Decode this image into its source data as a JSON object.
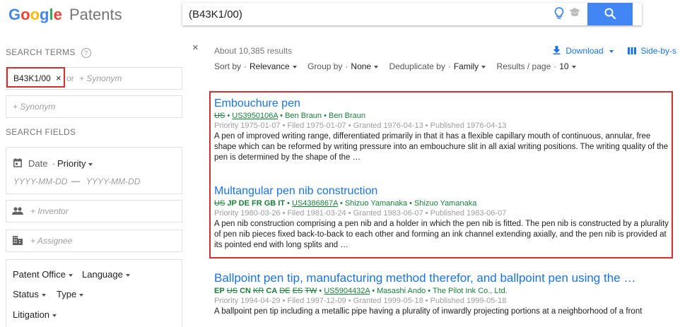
{
  "header": {
    "logo_letters": [
      "G",
      "o",
      "o",
      "g",
      "l",
      "e"
    ],
    "logo_colors": [
      "#4285f4",
      "#ea4335",
      "#fbbc05",
      "#4285f4",
      "#34a853",
      "#ea4335"
    ],
    "logo_suffix": "Patents",
    "search_query": "(B43K1/00)",
    "icons": {
      "bulb": "lightbulb-icon",
      "cap": "graduation-cap-icon",
      "search": "search-icon"
    }
  },
  "sidebar": {
    "search_terms_title": "SEARCH TERMS",
    "help_symbol": "?",
    "chip_label": "B43K1/00",
    "chip_remove": "×",
    "or_text": "or",
    "synonym_placeholder": "+ Synonym",
    "synonym_placeholder_2": "+ Synonym",
    "search_fields_title": "SEARCH FIELDS",
    "date_label": "Date",
    "date_sep": "·",
    "date_type": "Priority",
    "date_from_placeholder": "YYYY-MM-DD",
    "date_dash": "—",
    "date_to_placeholder": "YYYY-MM-DD",
    "inventor_placeholder": "+ Inventor",
    "assignee_placeholder": "+ Assignee",
    "filters": {
      "patent_office": "Patent Office",
      "language": "Language",
      "status": "Status",
      "type": "Type",
      "litigation": "Litigation"
    }
  },
  "results_header": {
    "close_symbol": "×",
    "count_text": "About 10,385 results",
    "download_label": "Download",
    "side_by_side_label": "Side-by-s",
    "sort_label": "Sort by",
    "sort_value": "Relevance",
    "group_label": "Group by",
    "group_value": "None",
    "dedupe_label": "Deduplicate by",
    "dedupe_value": "Family",
    "per_page_label": "Results / page",
    "per_page_value": "10",
    "dot": "·"
  },
  "results": [
    {
      "title": "Embouchure pen",
      "offices_struck": "US",
      "offices_active": "",
      "sep": " • ",
      "pub_number": "US3950106A",
      "inventors": "Ben Braun • Ben Braun",
      "dates": "Priority 1975-01-07 • Filed 1975-01-07 • Granted 1976-04-13 • Published 1976-04-13",
      "abstract": "A pen of improved writing range, differentiated primarily in that it has a flexible capillary mouth of continuous, annular, free shape which can be reformed by writing pressure into an embouchure slit in all axial writing positions. The writing quality of the pen is determined by the shape of the …"
    },
    {
      "title": "Multangular pen nib construction",
      "offices_struck": "US",
      "offices_active": "JP DE FR GB IT",
      "sep": " • ",
      "pub_number": "US4386867A",
      "inventors": "Shizuo Yamanaka • Shizuo Yamanaka",
      "dates": "Priority 1980-03-26 • Filed 1981-03-24 • Granted 1983-06-07 • Published 1983-06-07",
      "abstract": "A pen nib construction comprising a pen nib and a holder in which the pen nib is fitted. The pen nib is constructed by a plurality of pen nib pieces fixed back-to-back to each other and forming an ink channel extending axially, and the pen nib is provided at its pointed end with long splits and …"
    },
    {
      "title": "Ballpoint pen tip, manufacturing method therefor, and ballpoint pen using the …",
      "offices_mixed": [
        {
          "t": "EP",
          "s": false
        },
        {
          "t": "US",
          "s": true
        },
        {
          "t": "CN",
          "s": false
        },
        {
          "t": "KR",
          "s": true
        },
        {
          "t": "CA",
          "s": false
        },
        {
          "t": "DE",
          "s": true
        },
        {
          "t": "ES",
          "s": true
        },
        {
          "t": "TW",
          "s": true
        }
      ],
      "sep": " • ",
      "pub_number": "US5904432A",
      "inventors": "Masashi Ando • The Pilot Ink Co., Ltd.",
      "dates": "Priority 1994-04-29 • Filed 1997-12-09 • Granted 1999-05-18 • Published 1999-05-18",
      "abstract": "A ballpoint pen tip including a metallic pipe having a plurality of inwardly projecting portions at a neighborhood of a front"
    }
  ]
}
